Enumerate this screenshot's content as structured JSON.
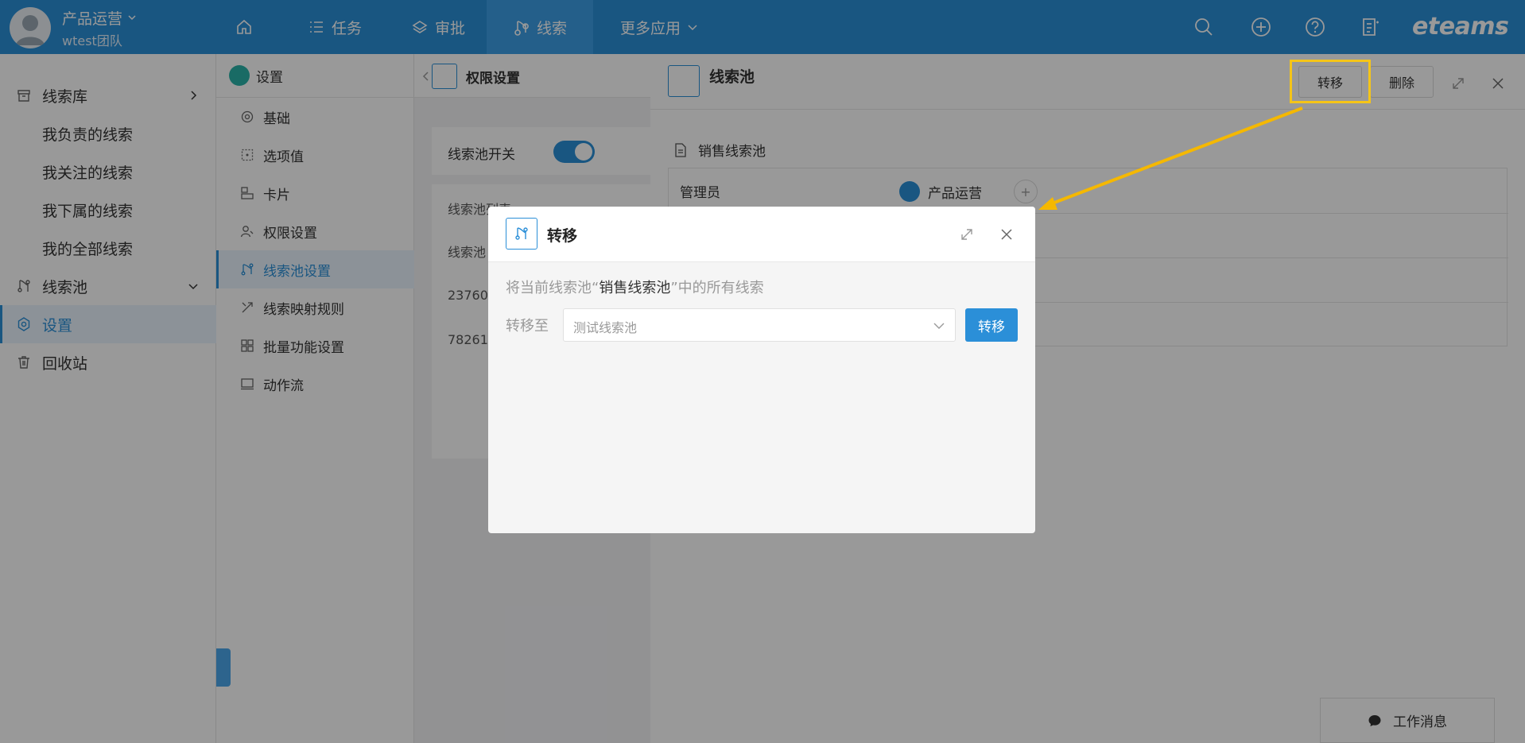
{
  "topbar": {
    "user_name": "产品运营",
    "team": "wtest团队",
    "nav": [
      {
        "label": ""
      },
      {
        "label": "任务"
      },
      {
        "label": "审批"
      },
      {
        "label": "线索"
      },
      {
        "label": "更多应用"
      }
    ],
    "brand": "eteams"
  },
  "sidebar": {
    "items": [
      {
        "label": "线索库"
      },
      {
        "label": "我负责的线索"
      },
      {
        "label": "我关注的线索"
      },
      {
        "label": "我下属的线索"
      },
      {
        "label": "我的全部线索"
      },
      {
        "label": "线索池"
      },
      {
        "label": "设置"
      },
      {
        "label": "回收站"
      }
    ]
  },
  "settings": {
    "title": "设置",
    "items": [
      {
        "label": "基础"
      },
      {
        "label": "选项值"
      },
      {
        "label": "卡片"
      },
      {
        "label": "权限设置"
      },
      {
        "label": "线索池设置"
      },
      {
        "label": "线索映射规则"
      },
      {
        "label": "批量功能设置"
      },
      {
        "label": "动作流"
      }
    ]
  },
  "middle": {
    "title": "权限设置",
    "switch_label": "线索池开关",
    "list_title": "线索池列表",
    "col_header": "线索池",
    "rows": [
      "23760",
      "78261"
    ]
  },
  "drawer": {
    "title": "线索池",
    "transfer_label": "转移",
    "delete_label": "删除",
    "section_title": "销售线索池",
    "admin_label": "管理员",
    "admin_name": "产品运营",
    "plus": "+"
  },
  "modal": {
    "title": "转移",
    "message_prefix": "将当前线索池“",
    "message_pool": "销售线索池",
    "message_suffix": "”中的所有线索",
    "field_label": "转移至",
    "select_value": "测试线索池",
    "confirm_label": "转移"
  },
  "chat": {
    "label": "工作消息"
  },
  "colors": {
    "accent": "#2b8fd8",
    "highlight": "#f5c518",
    "teal": "#2bb3a8"
  }
}
